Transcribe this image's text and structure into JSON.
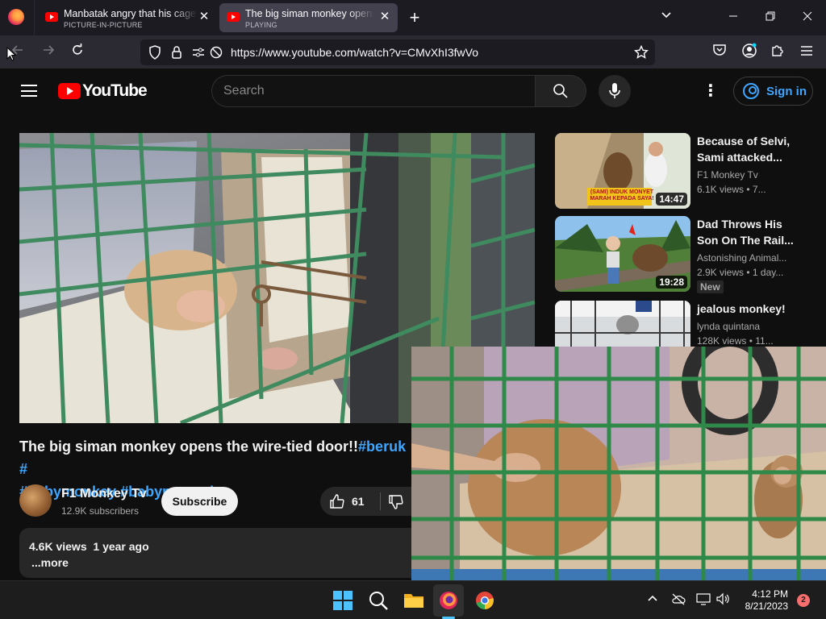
{
  "browser": {
    "tabs": [
      {
        "title": "Manbatak angry that his cage is",
        "subtitle": "PICTURE-IN-PICTURE"
      },
      {
        "title": "The big siman monkey opens the",
        "subtitle": "PLAYING"
      }
    ],
    "new_tab": "+",
    "url": "https://www.youtube.com/watch?v=CMvXhI3fwVo"
  },
  "youtube": {
    "logo_text": "YouTube",
    "search_placeholder": "Search",
    "signin_label": "Sign in"
  },
  "video": {
    "title_text": "The big siman monkey opens the wire-tied door!!",
    "hashtags": [
      "#beruk",
      "#",
      "#babymonkey",
      "#babymonpai"
    ],
    "channel_name": "F1 Monkey Tv",
    "subscribers": "12.9K subscribers",
    "subscribe_label": "Subscribe",
    "likes": "61",
    "views": "4.6K views",
    "age": "1 year ago",
    "more_label": "...more"
  },
  "recommendations": [
    {
      "title_line1": "Because of Selvi,",
      "title_line2": "Sami attacked...",
      "channel": "F1 Monkey Tv",
      "meta": "6.1K views  • 7...",
      "duration": "14:47",
      "thumb_caption": "(SAMI) INDUK MONYET MARAH KEPADA SAYA!"
    },
    {
      "title_line1": "Dad Throws His",
      "title_line2": "Son On The Rail...",
      "channel": "Astonishing Animal...",
      "meta": "2.9K views  • 1 day...",
      "duration": "19:28",
      "badge": "New"
    },
    {
      "title_line1": "jealous monkey!",
      "title_line2": "",
      "channel": "lynda quintana",
      "meta": "128K views  • 11..."
    }
  ],
  "taskbar": {
    "time": "4:12 PM",
    "date": "8/21/2023",
    "notifications": "2"
  }
}
